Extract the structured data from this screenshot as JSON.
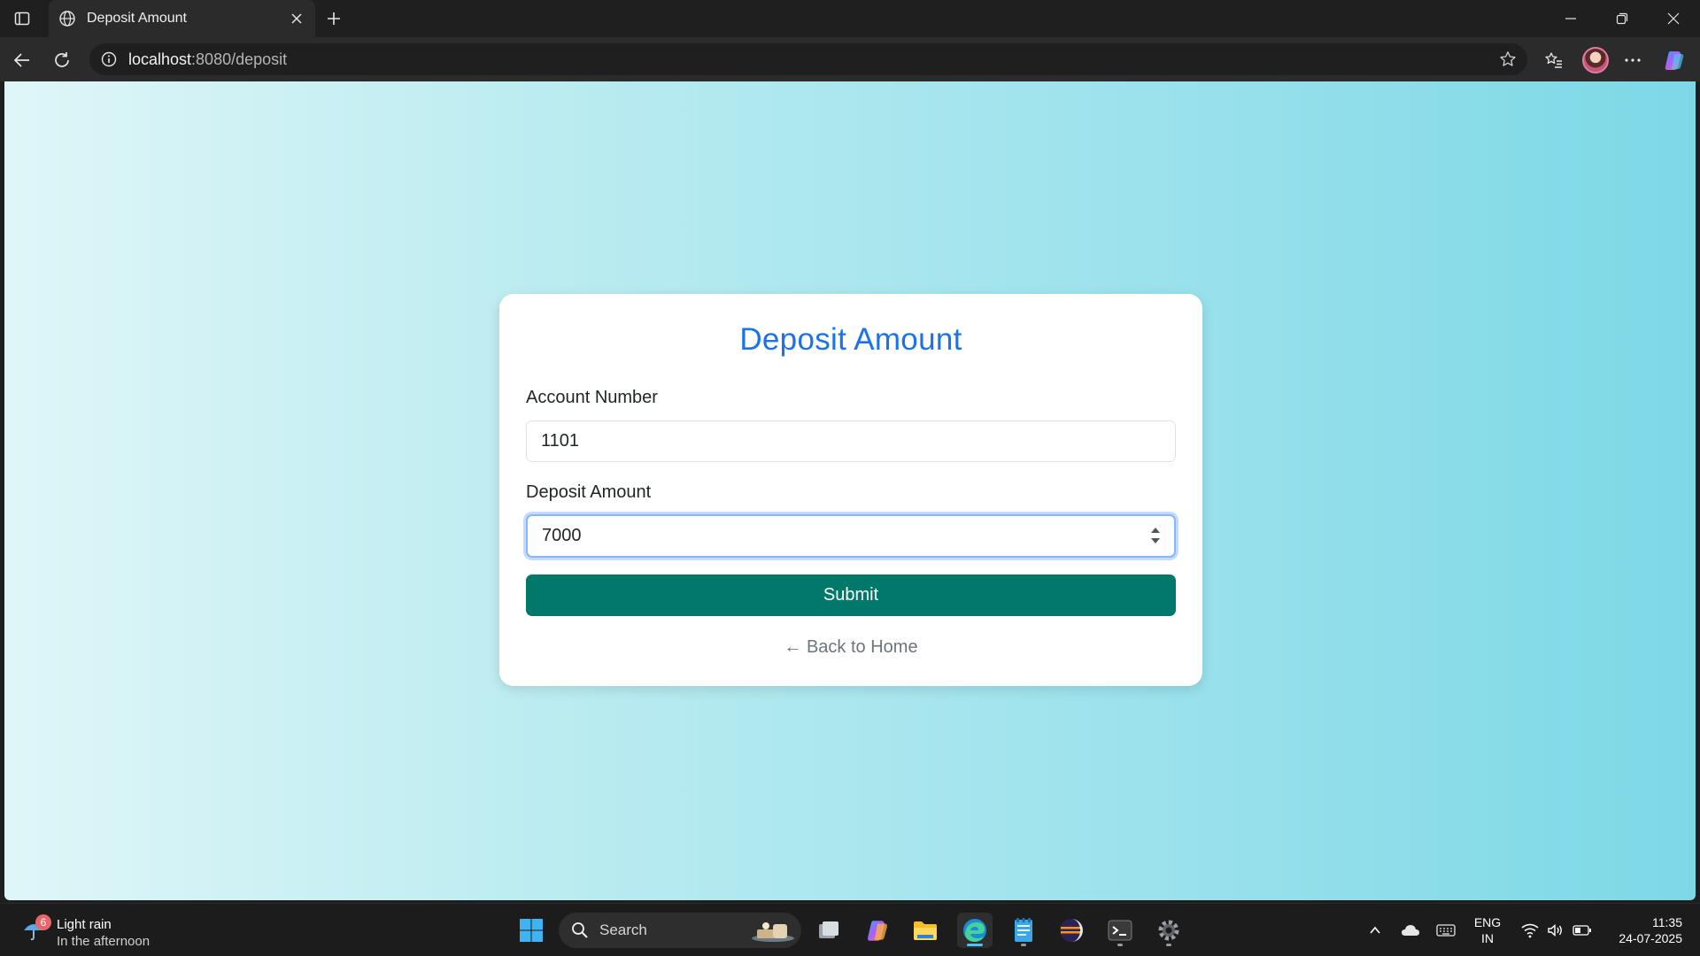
{
  "browser": {
    "tab_title": "Deposit Amount",
    "url_host": "localhost",
    "url_path": ":8080/deposit"
  },
  "page": {
    "heading": "Deposit Amount",
    "account_label": "Account Number",
    "account_value": "1101",
    "amount_label": "Deposit Amount",
    "amount_value": "7000",
    "submit_label": "Submit",
    "back_link": "← Back to Home",
    "colors": {
      "heading": "#1a73e8",
      "submit_bg": "#00796b",
      "focus_ring": "#86b7fe"
    }
  },
  "taskbar": {
    "weather_badge": "6",
    "weather_title": "Light rain",
    "weather_sub": "In the afternoon",
    "search_label": "Search",
    "lang_line1": "ENG",
    "lang_line2": "IN",
    "time": "11:35",
    "date": "24-07-2025",
    "pinned_icons": [
      "windows-start-icon",
      "task-view-icon",
      "copilot-icon",
      "file-explorer-icon",
      "edge-icon",
      "notepad-icon",
      "eclipse-icon",
      "terminal-icon",
      "settings-icon"
    ]
  }
}
